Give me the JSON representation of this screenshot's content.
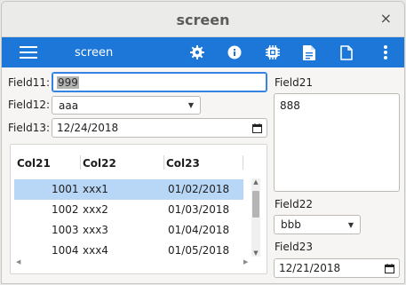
{
  "window": {
    "title": "screen",
    "close_glyph": "×"
  },
  "toolbar": {
    "menu_icon": "hamburger-menu-icon",
    "label": "screen",
    "icons": [
      "gear-icon",
      "info-icon",
      "chip-icon",
      "document-filled-icon",
      "document-outline-icon",
      "kebab-menu-icon"
    ],
    "accent": "#1c77d8"
  },
  "form_left": {
    "field11_label": "Field11:",
    "field11_value": "999",
    "field12_label": "Field12:",
    "field12_value": "aaa",
    "field13_label": "Field13:",
    "field13_value": "12/24/2018"
  },
  "table": {
    "columns": [
      "Col21",
      "Col22",
      "Col23"
    ],
    "rows": [
      {
        "c1": "1001",
        "c2": "xxx1",
        "c3": "01/02/2018",
        "selected": true
      },
      {
        "c1": "1002",
        "c2": "xxx2",
        "c3": "01/03/2018",
        "selected": false
      },
      {
        "c1": "1003",
        "c2": "xxx3",
        "c3": "01/04/2018",
        "selected": false
      },
      {
        "c1": "1004",
        "c2": "xxx4",
        "c3": "01/05/2018",
        "selected": false
      }
    ],
    "selection_color": "#b8d6f5"
  },
  "form_right": {
    "field21_label": "Field21",
    "field21_value": "888",
    "field22_label": "Field22",
    "field22_value": "bbb",
    "field23_label": "Field23",
    "field23_value": "12/21/2018"
  }
}
